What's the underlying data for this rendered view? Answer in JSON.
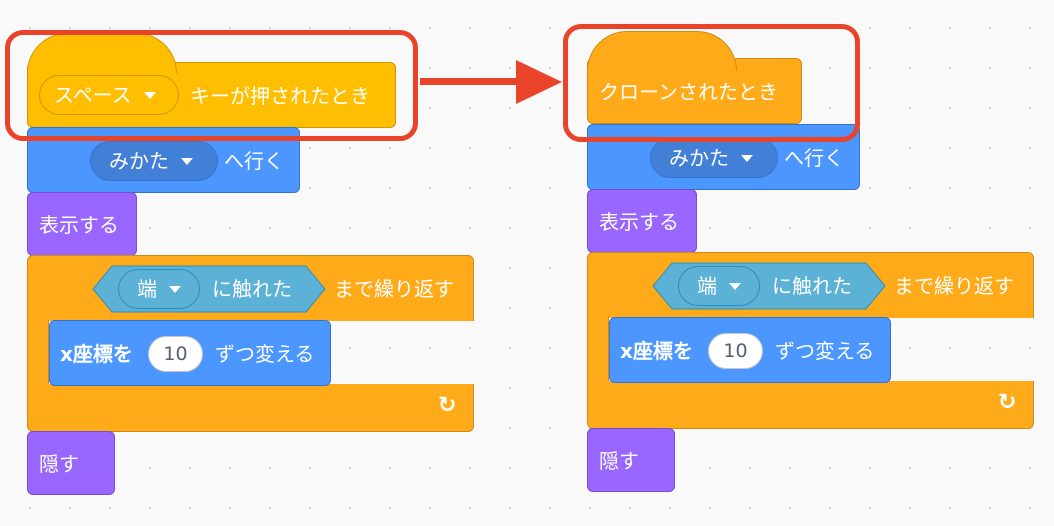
{
  "colors": {
    "events": "#ffbf00",
    "motion": "#4c97ff",
    "looks": "#9966ff",
    "control": "#ffab19",
    "sensing": "#5cb1d6",
    "highlight": "#e9432a"
  },
  "left_script": {
    "hat": {
      "key_menu": "スペース",
      "label": "キーが押されたとき"
    },
    "goto": {
      "menu": "みかた",
      "label": "へ行く"
    },
    "show": {
      "label": "表示する"
    },
    "repeat_until": {
      "menu": "端",
      "cond_label": "に触れた",
      "label": "まで繰り返す"
    },
    "change_x": {
      "label": "x座標を",
      "value": "10",
      "suffix": "ずつ変える"
    },
    "hide": {
      "label": "隠す"
    },
    "loop_icon": "loop-arrow-icon"
  },
  "right_script": {
    "hat": {
      "label": "クローンされたとき"
    },
    "goto": {
      "menu": "みかた",
      "label": "へ行く"
    },
    "show": {
      "label": "表示する"
    },
    "repeat_until": {
      "menu": "端",
      "cond_label": "に触れた",
      "label": "まで繰り返す"
    },
    "change_x": {
      "label": "x座標を",
      "value": "10",
      "suffix": "ずつ変える"
    },
    "hide": {
      "label": "隠す"
    },
    "loop_icon": "loop-arrow-icon"
  },
  "annotation": {
    "arrow_icon": "right-arrow-icon"
  }
}
